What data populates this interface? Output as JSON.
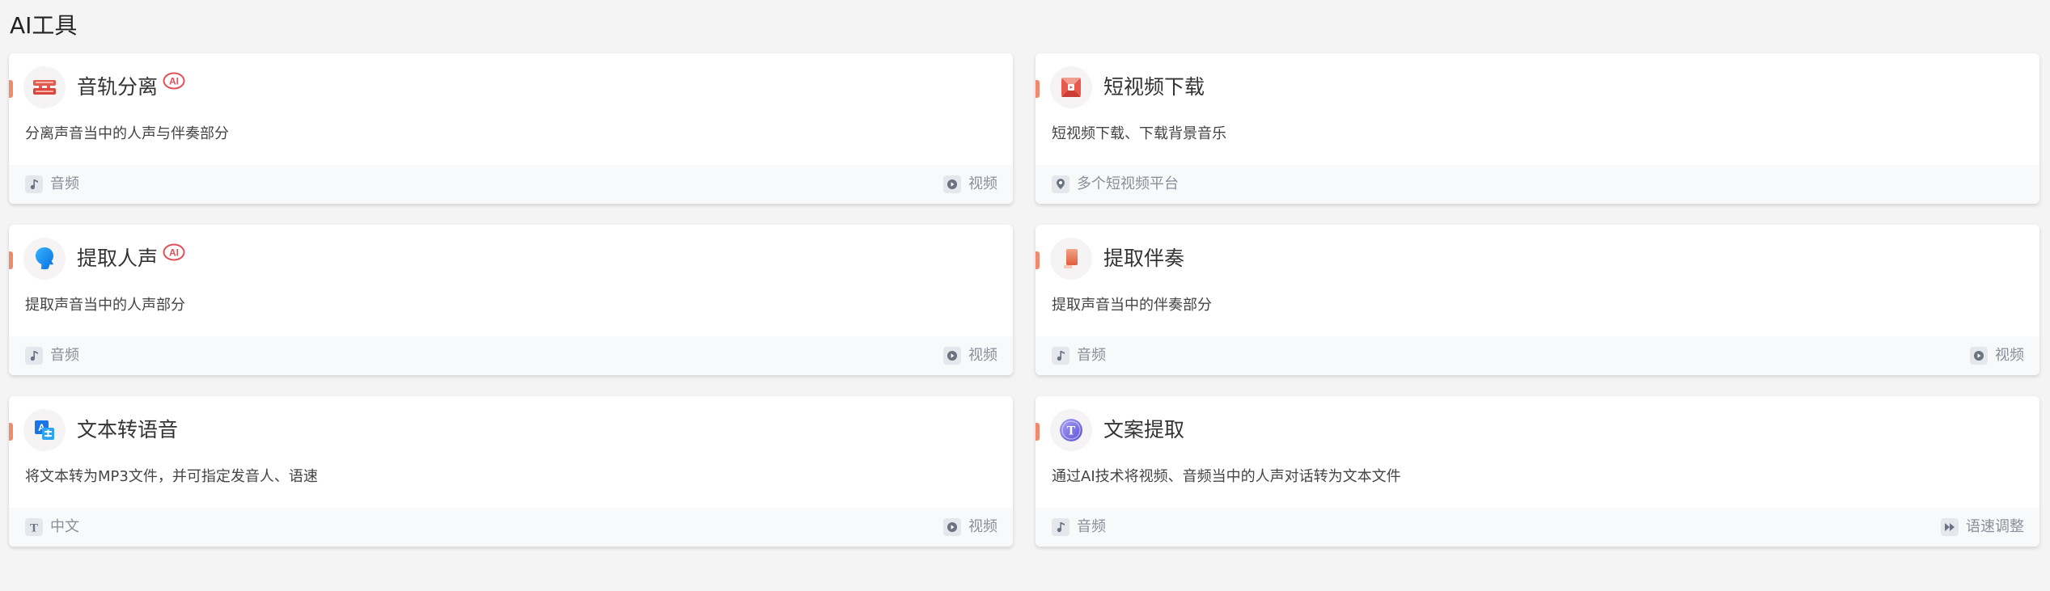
{
  "page": {
    "title": "AI工具"
  },
  "cards": [
    {
      "title": "音轨分离",
      "ai_badge": "AI",
      "icon": "track-split-icon",
      "description": "分离声音当中的人声与伴奏部分",
      "tag_left": {
        "label": "音频",
        "icon": "music-note-icon"
      },
      "tag_right": {
        "label": "视频",
        "icon": "play-circle-icon"
      }
    },
    {
      "title": "短视频下载",
      "icon": "video-download-icon",
      "description": "短视频下载、下载背景音乐",
      "tag_left": {
        "label": "多个短视频平台",
        "icon": "location-pin-icon"
      }
    },
    {
      "title": "提取人声",
      "ai_badge": "AI",
      "icon": "voice-head-icon",
      "description": "提取声音当中的人声部分",
      "tag_left": {
        "label": "音频",
        "icon": "music-note-icon"
      },
      "tag_right": {
        "label": "视频",
        "icon": "play-circle-icon"
      }
    },
    {
      "title": "提取伴奏",
      "icon": "accompaniment-icon",
      "description": "提取声音当中的伴奏部分",
      "tag_left": {
        "label": "音频",
        "icon": "music-note-icon"
      },
      "tag_right": {
        "label": "视频",
        "icon": "play-circle-icon"
      }
    },
    {
      "title": "文本转语音",
      "icon": "text-translate-icon",
      "description": "将文本转为MP3文件，并可指定发音人、语速",
      "tag_left": {
        "label": "中文",
        "icon": "text-t-icon"
      },
      "tag_right": {
        "label": "视频",
        "icon": "play-circle-icon"
      }
    },
    {
      "title": "文案提取",
      "icon": "text-extract-icon",
      "description": "通过AI技术将视频、音频当中的人声对话转为文本文件",
      "tag_left": {
        "label": "音频",
        "icon": "music-note-icon"
      },
      "tag_right": {
        "label": "语速调整",
        "icon": "fast-forward-icon"
      }
    }
  ],
  "colors": {
    "background": "#f4f4f4",
    "card": "#ffffff",
    "accent": "#f08a6e",
    "ai_badge": "#e0515a",
    "tag_text": "#8a8f99"
  }
}
